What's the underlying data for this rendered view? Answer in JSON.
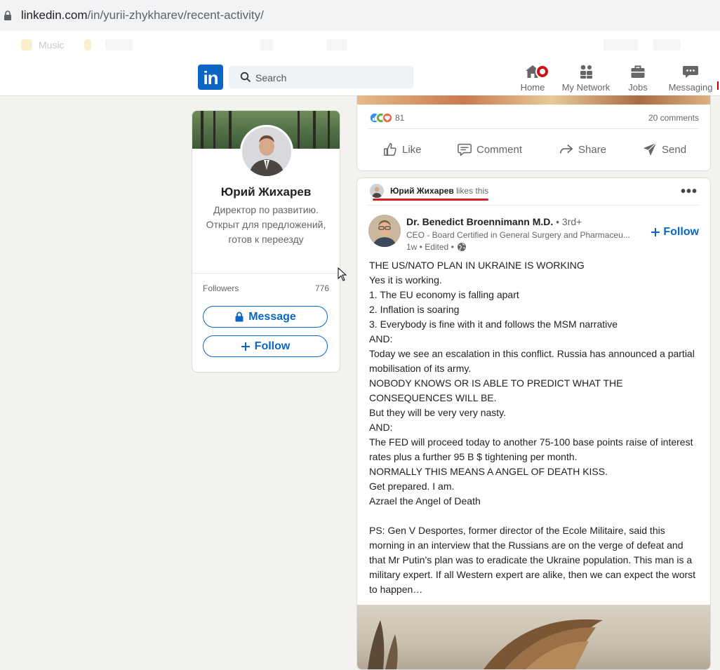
{
  "browser": {
    "url_domain": "linkedin.com",
    "url_path": "/in/yurii-zhykharev/recent-activity/",
    "bookmarks": [
      "Music"
    ]
  },
  "header": {
    "logo": "in",
    "search_placeholder": "Search",
    "nav": [
      {
        "label": "Home",
        "icon": "home-icon",
        "has_badge": true
      },
      {
        "label": "My Network",
        "icon": "network-icon"
      },
      {
        "label": "Jobs",
        "icon": "jobs-icon"
      },
      {
        "label": "Messaging",
        "icon": "messaging-icon"
      }
    ]
  },
  "profile": {
    "name": "Юрий Жихарев",
    "headline": "Директор по развитию. Открыт для предложений, готов к переезду",
    "followers_label": "Followers",
    "followers_count": "776",
    "message_label": "Message",
    "follow_label": "Follow"
  },
  "post1": {
    "reaction_count": "81",
    "comments": "20 comments",
    "actions": [
      "Like",
      "Comment",
      "Share",
      "Send"
    ]
  },
  "post2": {
    "liker_name": "Юрий Жихарев",
    "liker_action": "likes this",
    "author_name": "Dr. Benedict Broennimann M.D.",
    "author_degree": "• 3rd+",
    "author_title": "CEO - Board Certified in General Surgery and Pharmaceu...",
    "author_meta": "1w • Edited •",
    "follow_label": "Follow",
    "body_lines": [
      "THE US/NATO PLAN IN UKRAINE IS WORKING",
      "Yes it is working.",
      "1. The EU economy is falling apart",
      "2. Inflation is soaring",
      "3. Everybody is fine with it and follows the MSM narrative",
      "AND:",
      "Today we see an escalation in this conflict. Russia has announced a partial mobilisation of its army.",
      "NOBODY KNOWS OR IS ABLE TO PREDICT WHAT THE CONSEQUENCES WILL BE.",
      "But they will be very very nasty.",
      "AND:",
      "The FED will proceed today to another 75-100 base points raise of interest rates plus a further 95 B $ tightening per month.",
      "NORMALLY THIS MEANS A ANGEL OF DEATH KISS.",
      "Get prepared. I am.",
      "Azrael the Angel of Death",
      "",
      "PS: Gen V Desportes, former director of the Ecole Militaire, said this morning in an interview that the Russians are on the verge of defeat and that Mr Putin’s plan was to eradicate the Ukraine population. This man is a military expert. If all Western expert are alike, then we can expect the worst to happen…"
    ]
  },
  "colors": {
    "linkedin_blue": "#0a66c2",
    "badge_red": "#cc1016",
    "underline_red": "#d11f26"
  }
}
